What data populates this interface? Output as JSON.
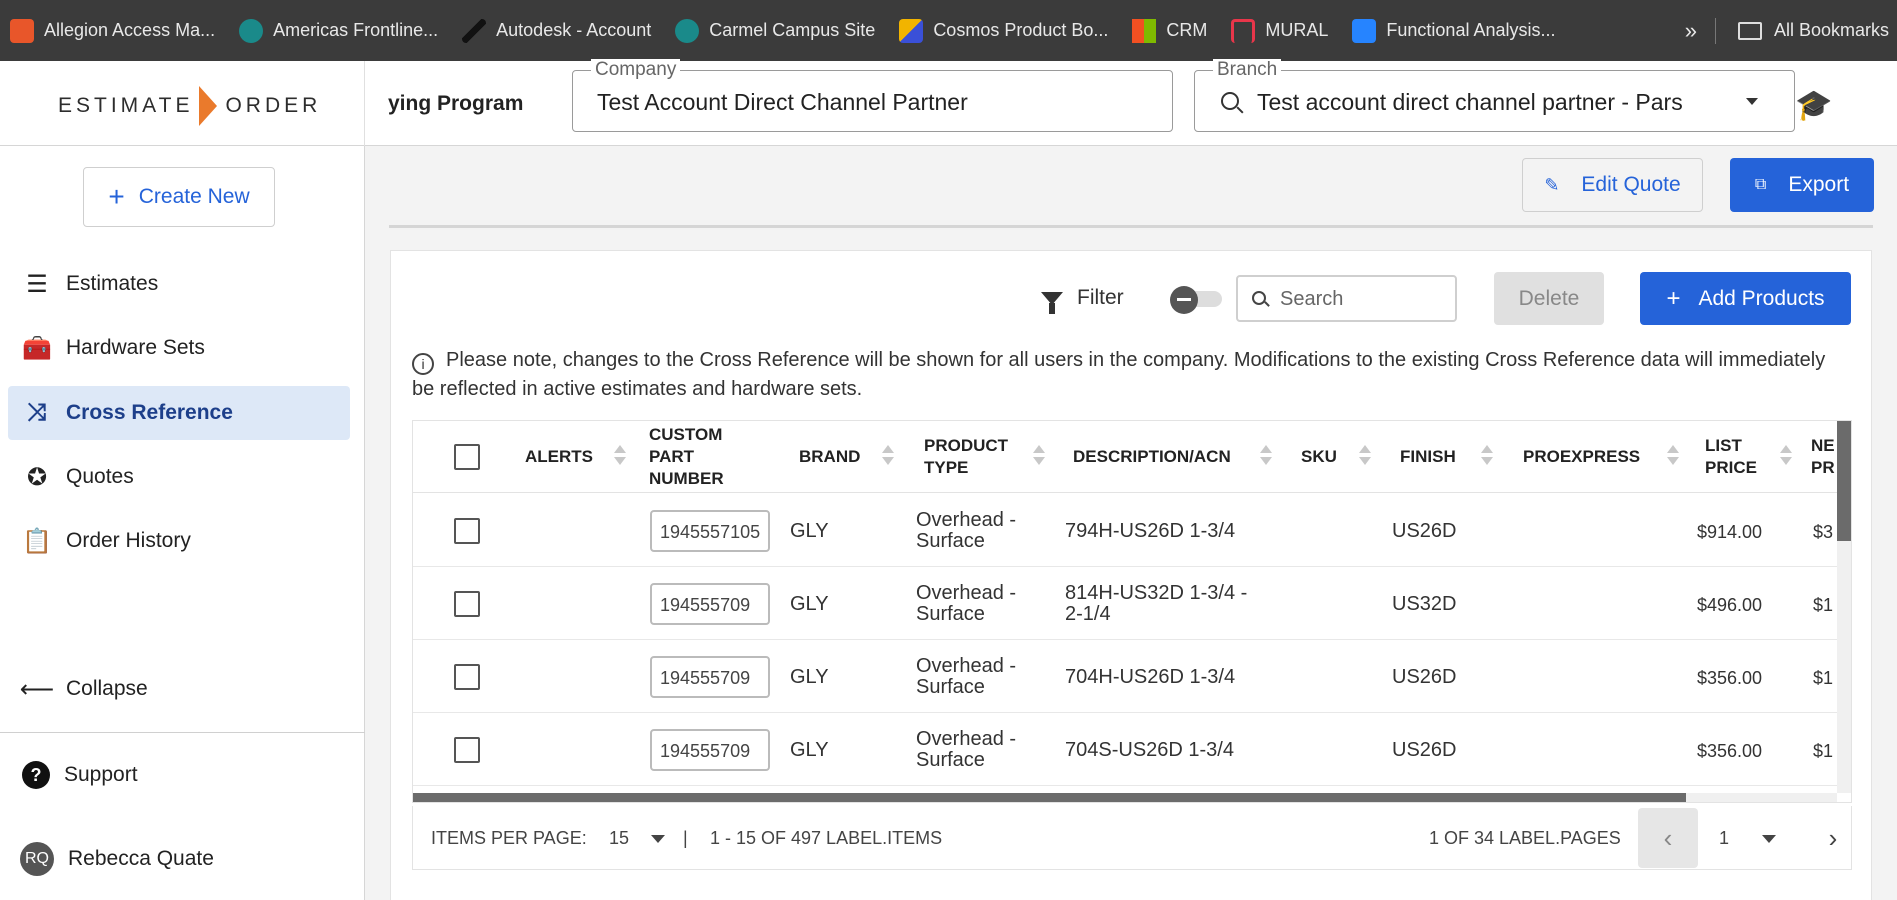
{
  "bookmarks": [
    {
      "label": "Allegion Access Ma...",
      "icon": "allegion-icon",
      "color": "#e8562a"
    },
    {
      "label": "Americas Frontline...",
      "icon": "sharepoint-icon",
      "color": "#1a8a8a"
    },
    {
      "label": "Autodesk - Account",
      "icon": "autodesk-icon",
      "color": "#111111"
    },
    {
      "label": "Carmel Campus Site",
      "icon": "sharepoint-icon",
      "color": "#1a8a8a"
    },
    {
      "label": "Cosmos Product Bo...",
      "icon": "cosmos-icon",
      "color": "#f2b400"
    },
    {
      "label": "CRM",
      "icon": "microsoft-icon",
      "color": "#f25022"
    },
    {
      "label": "MURAL",
      "icon": "mural-icon",
      "color": "#e8364a"
    },
    {
      "label": "Functional Analysis...",
      "icon": "confluence-icon",
      "color": "#2684ff"
    }
  ],
  "bookmarks_more": "»",
  "all_bookmarks": "All Bookmarks",
  "header": {
    "logo_left": "ESTIMATE",
    "logo_right": "ORDER",
    "program": "ying Program",
    "company_label": "Company",
    "company_value": "Test Account Direct Channel Partner",
    "branch_label": "Branch",
    "branch_value": "Test account direct channel partner - Pars"
  },
  "sidebar": {
    "create_new": "Create New",
    "items": [
      {
        "label": "Estimates",
        "icon": "list-icon"
      },
      {
        "label": "Hardware Sets",
        "icon": "toolbox-icon"
      },
      {
        "label": "Cross Reference",
        "icon": "cross-reference-icon"
      },
      {
        "label": "Quotes",
        "icon": "percent-badge-icon"
      },
      {
        "label": "Order History",
        "icon": "clipboard-icon"
      }
    ],
    "collapse": "Collapse",
    "support": "Support",
    "user_initials": "RQ",
    "user_name": "Rebecca Quate"
  },
  "actions": {
    "edit_quote": "Edit Quote",
    "export": "Export",
    "filter": "Filter",
    "search_placeholder": "Search",
    "delete": "Delete",
    "add_products": "Add Products"
  },
  "notice": "Please note, changes to the Cross Reference will be shown for all users in the company. Modifications to the existing Cross Reference data will immediately be reflected in active estimates and hardware sets.",
  "table": {
    "columns": {
      "alerts": "ALERTS",
      "custom_part_1": "CUSTOM",
      "custom_part_2": "PART",
      "custom_part_3": "NUMBER",
      "brand": "BRAND",
      "product_type_1": "PRODUCT",
      "product_type_2": "TYPE",
      "description": "DESCRIPTION/ACN",
      "sku": "SKU",
      "finish": "FINISH",
      "proexpress": "PROEXPRESS",
      "list_price_1": "LIST",
      "list_price_2": "PRICE",
      "net_price_1": "NE",
      "net_price_2": "PR"
    },
    "rows": [
      {
        "part": "1945557105",
        "brand": "GLY",
        "type_1": "Overhead -",
        "type_2": "Surface",
        "desc_1": "794H-US26D 1-3/4",
        "desc_2": "",
        "finish": "US26D",
        "list": "$914.00",
        "net": "$3"
      },
      {
        "part": "194555709",
        "brand": "GLY",
        "type_1": "Overhead -",
        "type_2": "Surface",
        "desc_1": "814H-US32D 1-3/4 -",
        "desc_2": "2-1/4",
        "finish": "US32D",
        "list": "$496.00",
        "net": "$1"
      },
      {
        "part": "194555709",
        "brand": "GLY",
        "type_1": "Overhead -",
        "type_2": "Surface",
        "desc_1": "704H-US26D 1-3/4",
        "desc_2": "",
        "finish": "US26D",
        "list": "$356.00",
        "net": "$1"
      },
      {
        "part": "194555709",
        "brand": "GLY",
        "type_1": "Overhead -",
        "type_2": "Surface",
        "desc_1": "704S-US26D 1-3/4",
        "desc_2": "",
        "finish": "US26D",
        "list": "$356.00",
        "net": "$1"
      }
    ]
  },
  "pager": {
    "items_per_page_label": "ITEMS PER PAGE:",
    "items_per_page": "15",
    "separator": "|",
    "range": "1 - 15 OF 497 LABEL.ITEMS",
    "pages": "1 OF 34 LABEL.PAGES",
    "current_page": "1"
  },
  "colors": {
    "accent": "#2563d9",
    "logo_chevron": "#ea7a2c",
    "active_nav_bg": "#dde8f7"
  }
}
